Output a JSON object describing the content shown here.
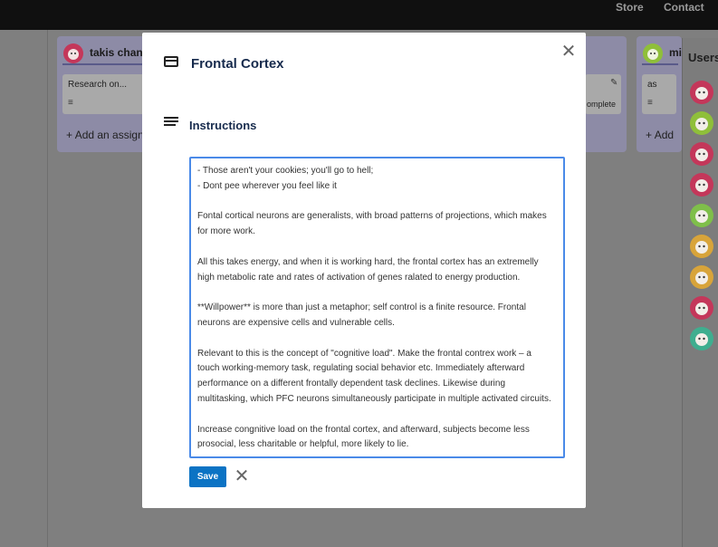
{
  "nav": {
    "store": "Store",
    "contact": "Contact"
  },
  "board": {
    "columns": [
      {
        "name": "takis chan",
        "card_text": "Research on...",
        "card_lines": "≡",
        "add_label": "Add an assign"
      },
      {
        "status": "omplete",
        "pencil": "✎"
      },
      {
        "name": "mi",
        "card_text": "as",
        "card_lines": "≡",
        "add_label": "Add"
      }
    ]
  },
  "users": {
    "title": "Users",
    "avatar_colors": [
      "#c4375a",
      "#8fbf3a",
      "#c4375a",
      "#c4375a",
      "#7fbf4a",
      "#d8a43a",
      "#d8a43a",
      "#c4375a",
      "#3fae8f"
    ]
  },
  "modal": {
    "title": "Frontal Cortex",
    "section_title": "Instructions",
    "description_lines": [
      "- Those aren't your cookies; you'll go to hell;",
      "- Dont pee wherever you feel like it",
      "",
      "Fontal cortical neurons are generalists, with broad patterns of projections, which makes",
      "for more work.",
      "",
      "All this takes energy, and when it is working hard, the frontal cortex has an extremelly",
      "high metabolic rate and rates of activation of genes ralated to energy production.",
      "",
      "**Willpower** is more than just a metaphor; self control is a finite resource. Frontal",
      "neurons are expensive cells and vulnerable cells.",
      "",
      "Relevant to this is the concept of \"cognitive load\". Make the frontal contrex work – a",
      "touch working-memory task, regulating social behavior etc. Immediately afterward",
      "performance on a different frontally dependent task declines. Likewise during",
      "multitasking, which PFC neurons simultaneously participate in multiple activated circuits.",
      "",
      "Increase congnitive load on the frontal cortex, and afterward, subjects become less",
      "prosocial, less charitable or helpful, more likely to lie."
    ],
    "save_label": "Save",
    "close_glyph": "✕",
    "cancel_glyph": "✕"
  }
}
